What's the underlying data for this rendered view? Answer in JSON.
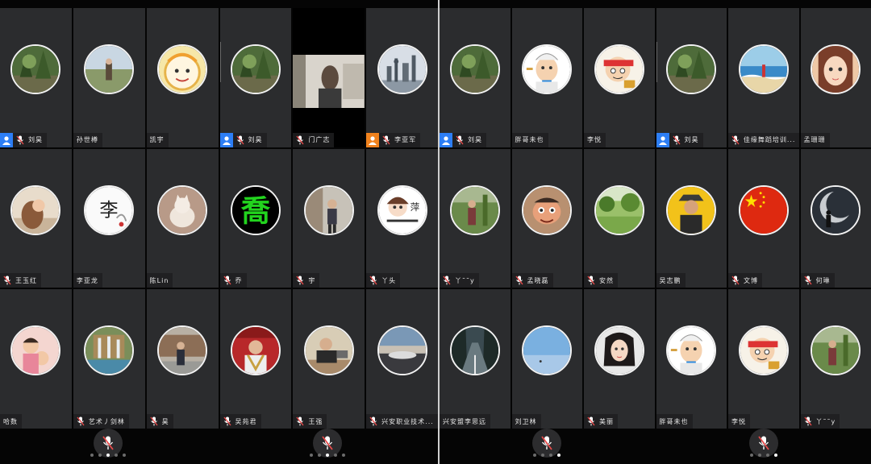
{
  "colors": {
    "host_blue": "#2d7ef5",
    "host_orange": "#f0821e",
    "tile_bg": "#2b2c2e",
    "mic_red": "#e84b4b"
  },
  "screens": [
    {
      "id": "left",
      "active_page": 2,
      "page_count": 5,
      "participants": [
        {
          "name": "刘昊",
          "avatar": "tree-photo",
          "host": "blue",
          "mic": true
        },
        {
          "name": "孙世樽",
          "avatar": "field-photo",
          "mic": false
        },
        {
          "name": "凯宇",
          "avatar": "cartoon-face",
          "mic": false,
          "sep_after": true
        },
        {
          "name": "刘昊",
          "avatar": "tree-photo",
          "host": "blue",
          "mic": true
        },
        {
          "name": "门广志",
          "avatar": "camera-video",
          "mic": true,
          "camera": true
        },
        {
          "name": "李亚军",
          "avatar": "city-skyline",
          "host": "orange",
          "mic": true
        },
        {
          "name": "王玉红",
          "avatar": "girl-painting",
          "mic": true
        },
        {
          "name": "李亚龙",
          "avatar": "calligraphy-li",
          "mic": false
        },
        {
          "name": "陈Lin",
          "avatar": "cat-photo",
          "mic": false
        },
        {
          "name": "乔",
          "avatar": "green-char",
          "mic": true
        },
        {
          "name": "宇",
          "avatar": "man-street",
          "mic": true
        },
        {
          "name": "丫头",
          "avatar": "girl-cartoon",
          "mic": true
        },
        {
          "name": "哈数",
          "avatar": "kids-photo",
          "mic": false
        },
        {
          "name": "艺术丿剑林",
          "avatar": "waterfall-photo",
          "mic": true
        },
        {
          "name": "昊",
          "avatar": "man-building",
          "mic": true
        },
        {
          "name": "吴苑君",
          "avatar": "man-red",
          "mic": true
        },
        {
          "name": "王强",
          "avatar": "man-desk",
          "mic": true
        },
        {
          "name": "兴安职业技术...",
          "avatar": "sunset-car",
          "mic": true
        }
      ]
    },
    {
      "id": "right",
      "active_page": 3,
      "page_count": 4,
      "participants": [
        {
          "name": "刘昊",
          "avatar": "tree-photo",
          "host": "blue",
          "mic": true
        },
        {
          "name": "胖哥未也",
          "avatar": "chef-cartoon",
          "mic": false
        },
        {
          "name": "李悦",
          "avatar": "ninja-cartoon",
          "mic": false,
          "sep_after": true
        },
        {
          "name": "刘昊",
          "avatar": "tree-photo",
          "host": "blue",
          "mic": true
        },
        {
          "name": "佳缘舞蹈培训...",
          "avatar": "beach-photo",
          "mic": true
        },
        {
          "name": "孟珊珊",
          "avatar": "girl-face",
          "mic": false
        },
        {
          "name": "丫˜˜y",
          "avatar": "man-garden",
          "mic": true
        },
        {
          "name": "孟晓磊",
          "avatar": "cartoon-boy",
          "mic": true
        },
        {
          "name": "安然",
          "avatar": "garden-photo",
          "mic": true
        },
        {
          "name": "吴志鹏",
          "avatar": "man-yellow",
          "mic": false
        },
        {
          "name": "文博",
          "avatar": "china-flag",
          "mic": true
        },
        {
          "name": "何琳",
          "avatar": "moon-person",
          "mic": true
        },
        {
          "name": "兴安盟李思远",
          "avatar": "road-forest",
          "mic": false
        },
        {
          "name": "刘卫林",
          "avatar": "sky-photo",
          "mic": false
        },
        {
          "name": "美丽",
          "avatar": "woman-photo",
          "mic": true
        },
        {
          "name": "胖哥未也",
          "avatar": "chef-cartoon",
          "mic": false
        },
        {
          "name": "李悦",
          "avatar": "ninja-cartoon",
          "mic": false
        },
        {
          "name": "丫˜˜y",
          "avatar": "man-garden",
          "mic": true
        }
      ]
    }
  ],
  "controls": {
    "mute_buttons": [
      {
        "icon": "mic-muted-icon"
      },
      {
        "icon": "mic-muted-icon"
      },
      {
        "icon": "mic-muted-icon"
      },
      {
        "icon": "mic-muted-icon"
      }
    ]
  }
}
